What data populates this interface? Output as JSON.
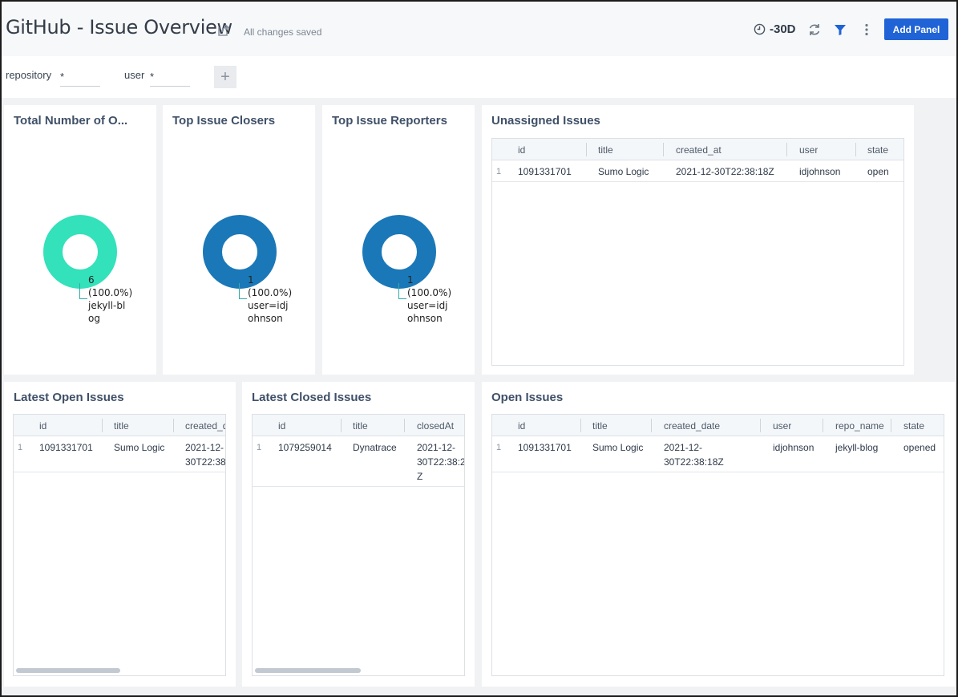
{
  "header": {
    "title": "GitHub - Issue Overview",
    "saved_status": "All changes saved",
    "time_range": "-30D",
    "add_panel_label": "Add Panel"
  },
  "filters": {
    "repository_label": "repository",
    "repository_value": "*",
    "user_label": "user",
    "user_value": "*",
    "add_label": "+"
  },
  "colors": {
    "accent": "#1f63d6",
    "teal": "#33e1bb",
    "blue": "#1a78b8"
  },
  "panels": {
    "total_open": {
      "title": "Total Number of O...",
      "value": "6",
      "percent": "(100.0%)",
      "name_line1": "jekyll-bl",
      "name_line2": "og"
    },
    "top_closers": {
      "title": "Top Issue Closers",
      "value": "1",
      "percent": "(100.0%)",
      "name_line1": "user=idj",
      "name_line2": "ohnson"
    },
    "top_reporters": {
      "title": "Top Issue Reporters",
      "value": "1",
      "percent": "(100.0%)",
      "name_line1": "user=idj",
      "name_line2": "ohnson"
    },
    "unassigned": {
      "title": "Unassigned Issues",
      "columns": [
        "id",
        "title",
        "created_at",
        "user",
        "state"
      ],
      "rows": [
        {
          "n": "1",
          "id": "1091331701",
          "title": "Sumo Logic",
          "created_at": "2021-12-30T22:38:18Z",
          "user": "idjohnson",
          "state": "open"
        }
      ]
    },
    "latest_open": {
      "title": "Latest Open Issues",
      "columns": [
        "id",
        "title",
        "created_d"
      ],
      "rows": [
        {
          "n": "1",
          "id": "1091331701",
          "title": "Sumo Logic",
          "created_line1": "2021-12-",
          "created_line2": "30T22:38"
        }
      ]
    },
    "latest_closed": {
      "title": "Latest Closed Issues",
      "columns": [
        "id",
        "title",
        "closedAt"
      ],
      "rows": [
        {
          "n": "1",
          "id": "1079259014",
          "title": "Dynatrace",
          "closed_line1": "2021-12-",
          "closed_line2": "30T22:38:2",
          "closed_line3": "Z"
        }
      ]
    },
    "open_issues": {
      "title": "Open Issues",
      "columns": [
        "id",
        "title",
        "created_date",
        "user",
        "repo_name",
        "state"
      ],
      "rows": [
        {
          "n": "1",
          "id": "1091331701",
          "title": "Sumo Logic",
          "created_line1": "2021-12-",
          "created_line2": "30T22:38:18Z",
          "user": "idjohnson",
          "repo_name": "jekyll-blog",
          "state": "opened"
        }
      ]
    }
  }
}
